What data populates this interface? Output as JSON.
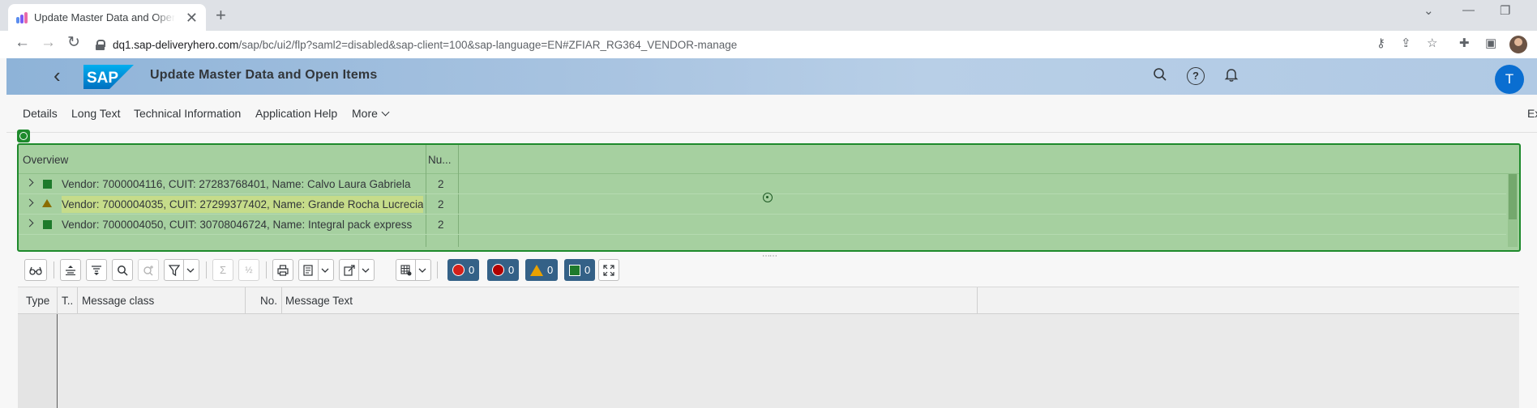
{
  "browser": {
    "tab_title": "Update Master Data and Open Items",
    "tab_close": "✕",
    "new_tab": "+",
    "url_host": "dq1.sap-deliveryhero.com",
    "url_path": "/sap/bc/ui2/flp?saml2=disabled&sap-client=100&sap-language=EN#ZFIAR_RG364_VENDOR-manage"
  },
  "shell": {
    "title": "Update Master Data and Open Items",
    "logo_text": "SAP",
    "avatar_letter": "T",
    "help_glyph": "?"
  },
  "menu": {
    "items": [
      "Details",
      "Long Text",
      "Technical Information",
      "Application Help",
      "More"
    ],
    "exit_partial": "Ex"
  },
  "overview": {
    "columns": [
      "Overview",
      "Nu..."
    ],
    "rows": [
      {
        "status": "ok",
        "text": "Vendor: 7000004116, CUIT: 27283768401, Name: Calvo Laura Gabriela",
        "count": "2"
      },
      {
        "status": "warning",
        "text": "Vendor: 7000004035, CUIT: 27299377402, Name: Grande Rocha Lucrecia",
        "count": "2"
      },
      {
        "status": "ok",
        "text": "Vendor: 7000004050, CUIT: 30708046724, Name: Integral pack express",
        "count": "2"
      }
    ]
  },
  "message_toolbar": {
    "counters": {
      "stop": "0",
      "error": "0",
      "warning": "0",
      "success": "0"
    }
  },
  "messages": {
    "columns": [
      "Type",
      "T..",
      "Message class",
      "No.",
      "Message Text"
    ]
  },
  "colors": {
    "accent": "#0a6ed1",
    "selection_green": "#a6d0a0",
    "selection_border": "#1e8a2c",
    "counter_bg": "#346187"
  }
}
